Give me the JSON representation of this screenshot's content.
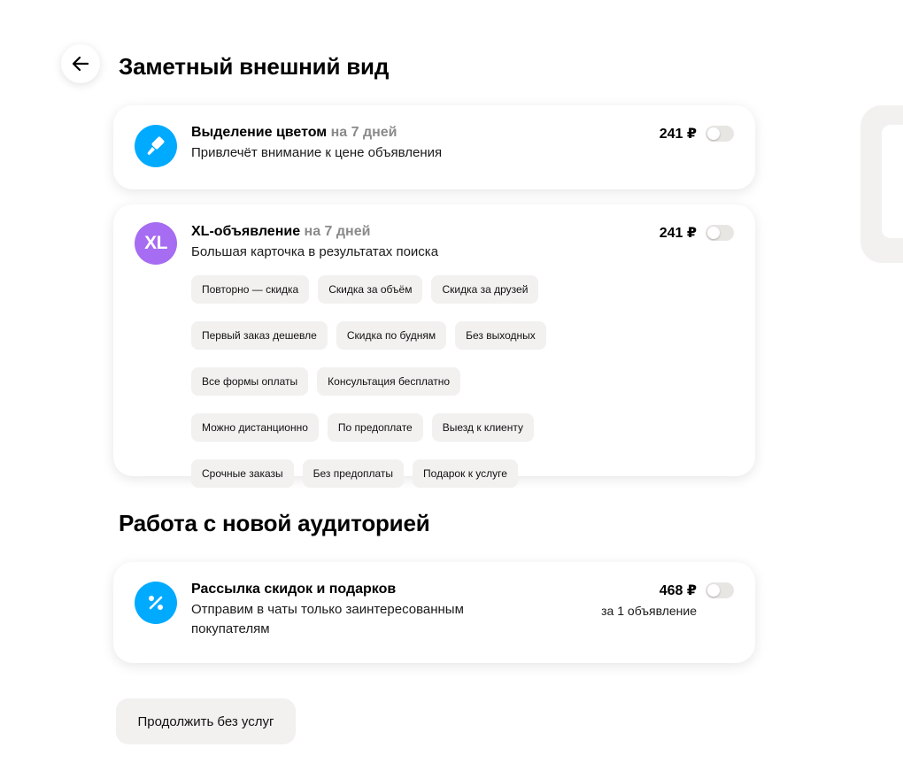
{
  "header": {
    "title": "Заметный внешний вид"
  },
  "services": [
    {
      "title": "Выделение цветом",
      "duration": "на 7 дней",
      "description": "Привлечёт внимание к цене объявления",
      "price": "241 ₽",
      "icon": "brush-icon",
      "icon_color": "#00aaff",
      "enabled": false
    },
    {
      "title": "XL-объявление",
      "duration": "на 7 дней",
      "description": "Большая карточка в результатах поиска",
      "price": "241 ₽",
      "icon": "xl-icon",
      "icon_text": "XL",
      "icon_color": "#a66cf2",
      "enabled": false,
      "tags": [
        "Повторно — скидка",
        "Скидка за объём",
        "Скидка за друзей",
        "Первый заказ дешевле",
        "Скидка по будням",
        "Без выходных",
        "Все формы оплаты",
        "Консультация бесплатно",
        "Можно дистанционно",
        "По предоплате",
        "Выезд к клиенту",
        "Срочные заказы",
        "Без предоплаты",
        "Подарок к услуге"
      ]
    }
  ],
  "audience": {
    "title": "Работа с новой аудиторией",
    "service": {
      "title": "Рассылка скидок и подарков",
      "description_line1": "Отправим в чаты только заинтересованным",
      "description_line2": "покупателям",
      "price": "468 ₽",
      "price_note": "за 1 объявление",
      "icon": "percent-icon",
      "icon_color": "#00aaff",
      "enabled": false
    }
  },
  "footer": {
    "continue_label": "Продолжить без услуг"
  }
}
